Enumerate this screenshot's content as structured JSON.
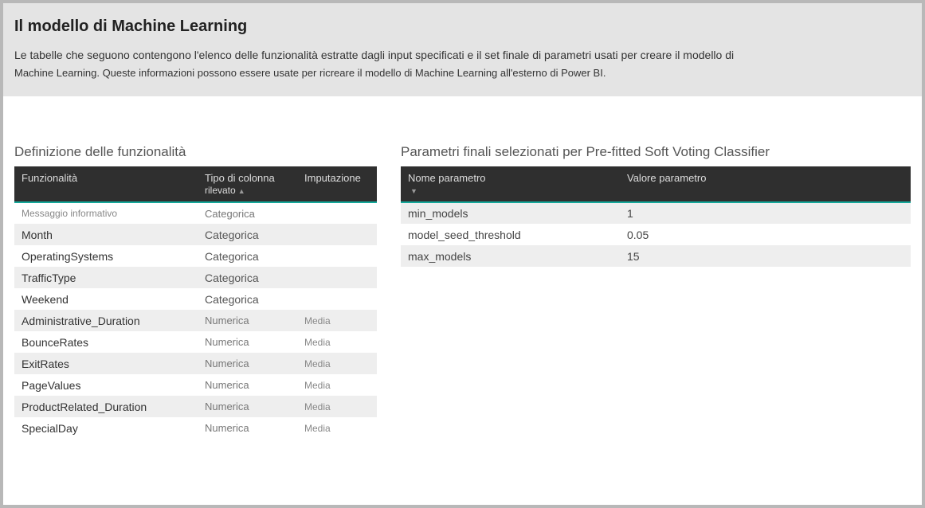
{
  "header": {
    "title": "Il modello di Machine Learning",
    "desc_line1": "Le tabelle che seguono contengono l'elenco delle funzionalità estratte dagli input specificati e il set finale di parametri usati per creare il modello di",
    "desc_line2": "Machine Learning. Queste informazioni possono essere usate per ricreare il modello di Machine Learning all'esterno di Power BI."
  },
  "features": {
    "section_title": "Definizione delle funzionalità",
    "columns": {
      "col1": "Funzionalità",
      "col2_line1": "Tipo di colonna",
      "col2_line2": "rilevato",
      "col3": "Imputazione"
    },
    "rows": [
      {
        "name": "Messaggio informativo",
        "type": "Categorica",
        "imp": "",
        "info": true
      },
      {
        "name": "Month",
        "type": "Categorica",
        "imp": ""
      },
      {
        "name": "OperatingSystems",
        "type": "Categorica",
        "imp": ""
      },
      {
        "name": "TrafficType",
        "type": "Categorica",
        "imp": ""
      },
      {
        "name": "Weekend",
        "type": "Categorica",
        "imp": ""
      },
      {
        "name": "Administrative_Duration",
        "type": "Numerica",
        "imp": "Media"
      },
      {
        "name": "BounceRates",
        "type": "Numerica",
        "imp": "Media"
      },
      {
        "name": "ExitRates",
        "type": "Numerica",
        "imp": "Media"
      },
      {
        "name": "PageValues",
        "type": "Numerica",
        "imp": "Media"
      },
      {
        "name": "ProductRelated_Duration",
        "type": "Numerica",
        "imp": "Media"
      },
      {
        "name": "SpecialDay",
        "type": "Numerica",
        "imp": "Media"
      }
    ]
  },
  "params": {
    "section_title": "Parametri finali selezionati per Pre-fitted Soft Voting Classifier",
    "columns": {
      "col1": "Nome parametro",
      "col2": "Valore parametro"
    },
    "rows": [
      {
        "name": "min_models",
        "value": "1"
      },
      {
        "name": "model_seed_threshold",
        "value": "0.05"
      },
      {
        "name": "max_models",
        "value": "15"
      }
    ]
  }
}
